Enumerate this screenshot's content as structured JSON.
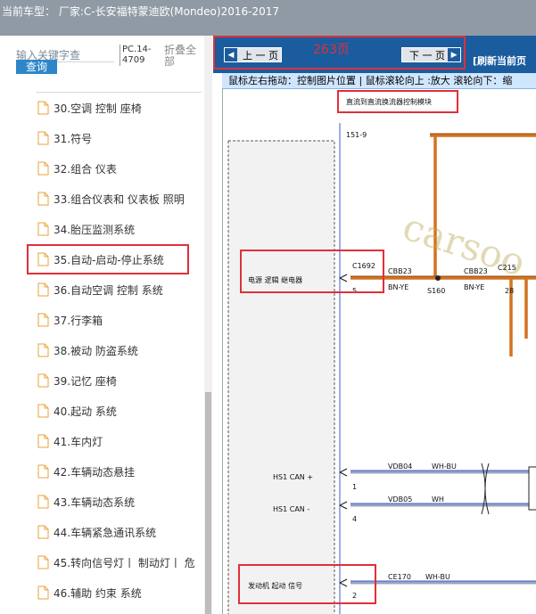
{
  "window": {
    "title": "当前车型：  厂家:C-长安福特蒙迪欧(Mondeo)2016-2017"
  },
  "sidebar": {
    "search_placeholder": "输入关键字查",
    "search_button": "查询",
    "pc_label": "PC.14-4709",
    "collapse_label": "折叠全部",
    "items": [
      "30.空调 控制 座椅",
      "31.符号",
      "32.组合 仪表",
      "33.组合仪表和 仪表板 照明",
      "34.胎压监测系统",
      "35.自动-启动-停止系统",
      "36.自动空调 控制 系统",
      "37.行李箱",
      "38.被动 防盗系统",
      "39.记忆 座椅",
      "40.起动 系统",
      "41.车内灯",
      "42.车辆动态悬挂",
      "43.车辆动态系统",
      "44.车辆紧急通讯系统",
      "45.转向信号灯丨 制动灯丨 危",
      "46.辅助 约束 系统"
    ],
    "highlighted_index": 5
  },
  "viewer": {
    "prev_label": "上 一 页",
    "next_label": "下 一 页",
    "page_number": "263页",
    "refresh_label": "[刷新当前页",
    "hint": "鼠标左右拖动：控制图片位置 | 鼠标滚轮向上 :放大  滚轮向下：缩"
  },
  "diagram": {
    "module_title": "直流到直流换流器控制模块",
    "ref": "151-9",
    "labels": {
      "power_relay": "电源 逻辑 继电器",
      "c1692": "C1692",
      "pin5": "5",
      "cbb23_a": "CBB23",
      "bn_ye_a": "BN-YE",
      "s160": "S160",
      "cbb23_b": "CBB23",
      "bn_ye_b": "BN-YE",
      "c215": "C215",
      "pin28": "28",
      "hs1_can_p": "HS1 CAN +",
      "pin1": "1",
      "vdb04": "VDB04",
      "wh_bu_a": "WH-BU",
      "hs1_can_m": "HS1 CAN -",
      "pin4": "4",
      "vdb05": "VDB05",
      "wh": "WH",
      "engine_start": "发动机 起动 信号",
      "pin2": "2",
      "ce170": "CE170",
      "wh_bu_b": "WH-BU"
    },
    "watermark": "carsoo",
    "wire_color_orange": "#d4731f",
    "wire_color_blue": "#3a5fcf",
    "highlight_color": "#e0303a"
  }
}
